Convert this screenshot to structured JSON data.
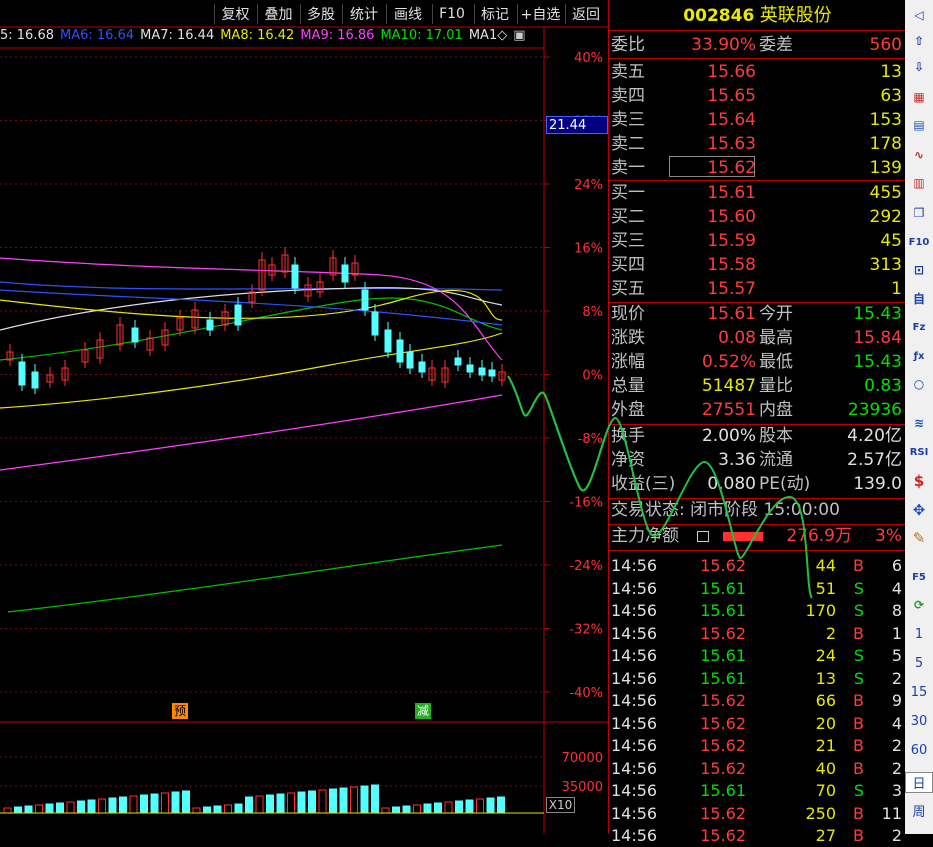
{
  "toolbar": {
    "items": [
      "复权",
      "叠加",
      "多股",
      "统计",
      "画线",
      "F10",
      "标记",
      "+自选",
      "返回"
    ]
  },
  "ma_legend": [
    {
      "label": "5: 16.68",
      "color": "#e0e0e0"
    },
    {
      "label": "MA6: 16.64",
      "color": "#3050ff"
    },
    {
      "label": "MA7: 16.44",
      "color": "#e0e0e0"
    },
    {
      "label": "MA8: 16.42",
      "color": "#e8e800"
    },
    {
      "label": "MA9: 16.86",
      "color": "#ff40ff"
    },
    {
      "label": "MA10: 17.01",
      "color": "#00e000"
    },
    {
      "label": "MA1◇",
      "color": "#e0e0e0"
    }
  ],
  "price_axis": [
    "40%",
    "32%",
    "24%",
    "16%",
    "8%",
    "0%",
    "-8%",
    "-16%",
    "-24%",
    "-32%",
    "-40%"
  ],
  "price_box": "21.44",
  "volume_axis": [
    "70000",
    "35000"
  ],
  "volume_multiplier": "X10",
  "event_markers": [
    {
      "text": "预",
      "color": "#ff8a00"
    },
    {
      "text": "减",
      "color": "#20b020"
    }
  ],
  "stock": {
    "code": "002846",
    "name": "英联股份"
  },
  "order_ratio": {
    "label": "委比",
    "value": "33.90%",
    "diff_label": "委差",
    "diff": "560"
  },
  "asks": [
    {
      "label": "卖五",
      "price": "15.66",
      "vol": "13"
    },
    {
      "label": "卖四",
      "price": "15.65",
      "vol": "63"
    },
    {
      "label": "卖三",
      "price": "15.64",
      "vol": "153"
    },
    {
      "label": "卖二",
      "price": "15.63",
      "vol": "178"
    },
    {
      "label": "卖一",
      "price": "15.62",
      "vol": "139"
    }
  ],
  "bids": [
    {
      "label": "买一",
      "price": "15.61",
      "vol": "455"
    },
    {
      "label": "买二",
      "price": "15.60",
      "vol": "292"
    },
    {
      "label": "买三",
      "price": "15.59",
      "vol": "45"
    },
    {
      "label": "买四",
      "price": "15.58",
      "vol": "313"
    },
    {
      "label": "买五",
      "price": "15.57",
      "vol": "1"
    }
  ],
  "quote": [
    {
      "l1": "现价",
      "v1": "15.61",
      "c1": "red",
      "l2": "今开",
      "v2": "15.43",
      "c2": "green"
    },
    {
      "l1": "涨跌",
      "v1": "0.08",
      "c1": "red",
      "l2": "最高",
      "v2": "15.84",
      "c2": "red"
    },
    {
      "l1": "涨幅",
      "v1": "0.52%",
      "c1": "red",
      "l2": "最低",
      "v2": "15.43",
      "c2": "green"
    },
    {
      "l1": "总量",
      "v1": "51487",
      "c1": "yellow",
      "l2": "量比",
      "v2": "0.83",
      "c2": "green"
    },
    {
      "l1": "外盘",
      "v1": "27551",
      "c1": "red",
      "l2": "内盘",
      "v2": "23936",
      "c2": "green"
    }
  ],
  "fundamentals": [
    {
      "l1": "换手",
      "v1": "2.00%",
      "l2": "股本",
      "v2": "4.20亿"
    },
    {
      "l1": "净资",
      "v1": "3.36",
      "l2": "流通",
      "v2": "2.57亿"
    },
    {
      "l1": "收益(三)",
      "v1": "0.080",
      "l2": "PE(动)",
      "v2": "139.0"
    }
  ],
  "trade_status": "交易状态: 闭市阶段 15:00:00",
  "main_force": {
    "label": "主力净额",
    "amount": "276.9万",
    "pct": "3%"
  },
  "ticks": [
    {
      "t": "14:56",
      "p": "15.62",
      "v": "44",
      "s": "B",
      "n": "6"
    },
    {
      "t": "14:56",
      "p": "15.61",
      "v": "51",
      "s": "S",
      "n": "4"
    },
    {
      "t": "14:56",
      "p": "15.61",
      "v": "170",
      "s": "S",
      "n": "8"
    },
    {
      "t": "14:56",
      "p": "15.62",
      "v": "2",
      "s": "B",
      "n": "1"
    },
    {
      "t": "14:56",
      "p": "15.61",
      "v": "24",
      "s": "S",
      "n": "5"
    },
    {
      "t": "14:56",
      "p": "15.61",
      "v": "13",
      "s": "S",
      "n": "2"
    },
    {
      "t": "14:56",
      "p": "15.62",
      "v": "66",
      "s": "B",
      "n": "9"
    },
    {
      "t": "14:56",
      "p": "15.62",
      "v": "20",
      "s": "B",
      "n": "4"
    },
    {
      "t": "14:56",
      "p": "15.62",
      "v": "21",
      "s": "B",
      "n": "2"
    },
    {
      "t": "14:56",
      "p": "15.62",
      "v": "40",
      "s": "B",
      "n": "2"
    },
    {
      "t": "14:56",
      "p": "15.61",
      "v": "70",
      "s": "S",
      "n": "3"
    },
    {
      "t": "14:56",
      "p": "15.62",
      "v": "250",
      "s": "B",
      "n": "11"
    },
    {
      "t": "14:56",
      "p": "15.62",
      "v": "27",
      "s": "B",
      "n": "2"
    }
  ],
  "sidebar_periods": [
    "1",
    "5",
    "15",
    "30",
    "60",
    "日",
    "周"
  ]
}
